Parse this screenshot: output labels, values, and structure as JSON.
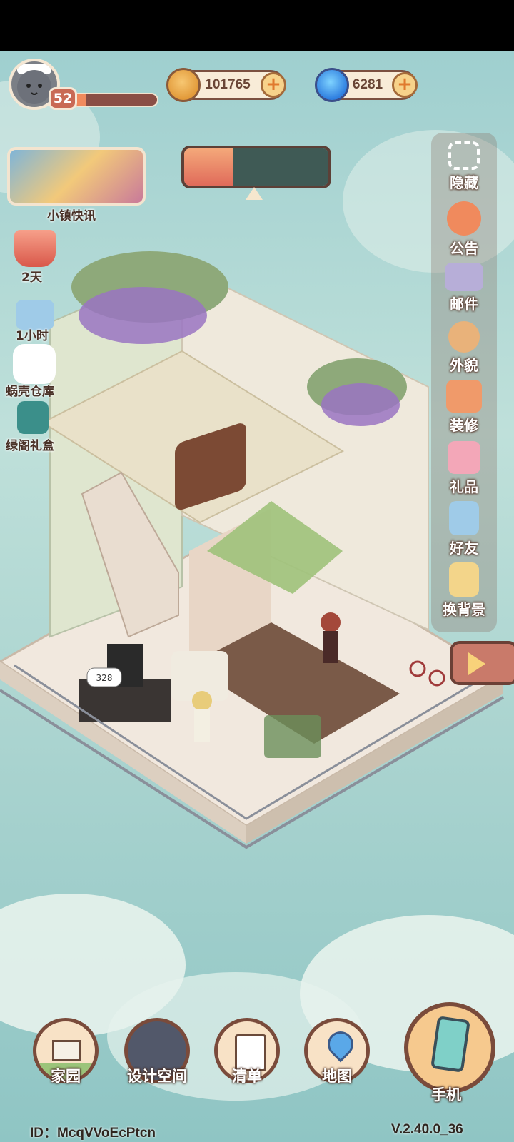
{
  "player": {
    "level": "52",
    "xp_fraction": 0.15
  },
  "currencies": {
    "coins": {
      "value": "101765",
      "icon": "coin-icon"
    },
    "gems": {
      "value": "6281",
      "icon": "gem-icon"
    }
  },
  "left_menu": {
    "news_label": "小镇快讯",
    "event1_label": "2天",
    "event2_label": "1小时",
    "warehouse_label": "蜗壳仓库",
    "giftbox_label": "绿阁礼盒"
  },
  "right_menu": [
    {
      "label": "隐藏",
      "icon": "hide-frame-icon",
      "color": "#ffffff"
    },
    {
      "label": "公告",
      "icon": "announcement-horn-icon",
      "color": "#f08a5d"
    },
    {
      "label": "邮件",
      "icon": "mail-envelope-icon",
      "color": "#b7aed8"
    },
    {
      "label": "外貌",
      "icon": "character-face-icon",
      "color": "#e9b27a"
    },
    {
      "label": "装修",
      "icon": "house-wrench-icon",
      "color": "#f09a6a"
    },
    {
      "label": "礼品",
      "icon": "gift-box-icon",
      "color": "#f3a7b8"
    },
    {
      "label": "好友",
      "icon": "friend-card-icon",
      "color": "#9fcbe8"
    },
    {
      "label": "换背景",
      "icon": "background-change-icon",
      "color": "#f3d58a"
    }
  ],
  "scene": {
    "bubble_count": "328"
  },
  "bottom_nav": {
    "home": "家园",
    "design": "设计空间",
    "list": "清单",
    "map": "地图",
    "phone": "手机"
  },
  "footer": {
    "id_text": "ID：McqVVoEcPtcn",
    "version": "V.2.40.0_36"
  }
}
